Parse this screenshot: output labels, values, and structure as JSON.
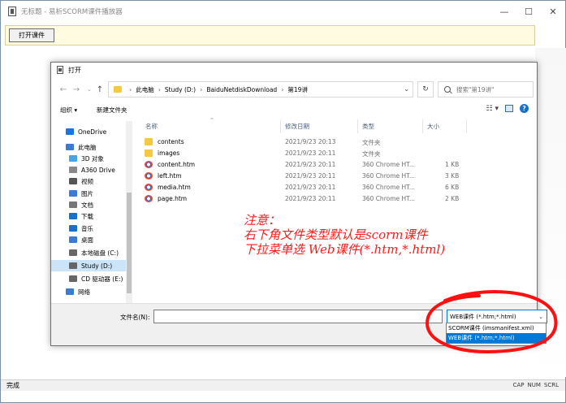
{
  "app": {
    "title": "无标题 - 易析SCORM课件播放器",
    "open_button": "打开课件",
    "status": "完成",
    "indicators": [
      "CAP",
      "NUM",
      "SCRL"
    ]
  },
  "dialog": {
    "title": "打开",
    "breadcrumb": [
      "此电脑",
      "Study (D:)",
      "BaiduNetdiskDownload",
      "第19讲"
    ],
    "search_placeholder": "搜索\"第19讲\"",
    "organize": "组织 ▾",
    "new_folder": "新建文件夹",
    "nav": [
      {
        "label": "OneDrive",
        "icon": "cloud-icon",
        "color": "#1a73e8"
      },
      {
        "label": "此电脑",
        "icon": "computer-icon",
        "color": "#3a7bd5"
      },
      {
        "label": "3D 对象",
        "icon": "cube-icon",
        "color": "#4ba3e3"
      },
      {
        "label": "A360 Drive",
        "icon": "drive-icon",
        "color": "#888888"
      },
      {
        "label": "视频",
        "icon": "video-icon",
        "color": "#555555"
      },
      {
        "label": "图片",
        "icon": "picture-icon",
        "color": "#3a7bd5"
      },
      {
        "label": "文档",
        "icon": "document-icon",
        "color": "#777777"
      },
      {
        "label": "下载",
        "icon": "download-icon",
        "color": "#1a6fc7"
      },
      {
        "label": "音乐",
        "icon": "music-icon",
        "color": "#1a6fc7"
      },
      {
        "label": "桌面",
        "icon": "desktop-icon",
        "color": "#3a7bd5"
      },
      {
        "label": "本地磁盘 (C:)",
        "icon": "disk-icon",
        "color": "#666666"
      },
      {
        "label": "Study (D:)",
        "icon": "disk-icon",
        "color": "#666666"
      },
      {
        "label": "CD 驱动器 (E:)",
        "icon": "cd-icon",
        "color": "#666666"
      },
      {
        "label": "网络",
        "icon": "network-icon",
        "color": "#3a7bd5"
      }
    ],
    "columns": {
      "name": "名称",
      "modified": "修改日期",
      "type": "类型",
      "size": "大小"
    },
    "files": [
      {
        "name": "contents",
        "modified": "2021/9/23 20:13",
        "type": "文件夹",
        "size": "",
        "kind": "folder"
      },
      {
        "name": "images",
        "modified": "2021/9/23 20:11",
        "type": "文件夹",
        "size": "",
        "kind": "folder"
      },
      {
        "name": "content.htm",
        "modified": "2021/9/23 20:11",
        "type": "360 Chrome HT...",
        "size": "1 KB",
        "kind": "htm"
      },
      {
        "name": "left.htm",
        "modified": "2021/9/23 20:11",
        "type": "360 Chrome HT...",
        "size": "3 KB",
        "kind": "htm"
      },
      {
        "name": "media.htm",
        "modified": "2021/9/23 20:11",
        "type": "360 Chrome HT...",
        "size": "6 KB",
        "kind": "htm"
      },
      {
        "name": "page.htm",
        "modified": "2021/9/23 20:11",
        "type": "360 Chrome HT...",
        "size": "2 KB",
        "kind": "htm"
      }
    ],
    "filename_label": "文件名(N):",
    "filename_value": "",
    "filetype_selected": "WEB课件 (*.htm;*.html)",
    "filetype_options": [
      "SCORM课件 (imsmanifest.xml)",
      "WEB课件 (*.htm;*.html)"
    ]
  },
  "annotation": {
    "lines": [
      "注意：",
      "右下角文件类型默认是scorm课件",
      "下拉菜单选 Web课件(*.htm,*.html)"
    ],
    "color": "#ff1a1a"
  }
}
